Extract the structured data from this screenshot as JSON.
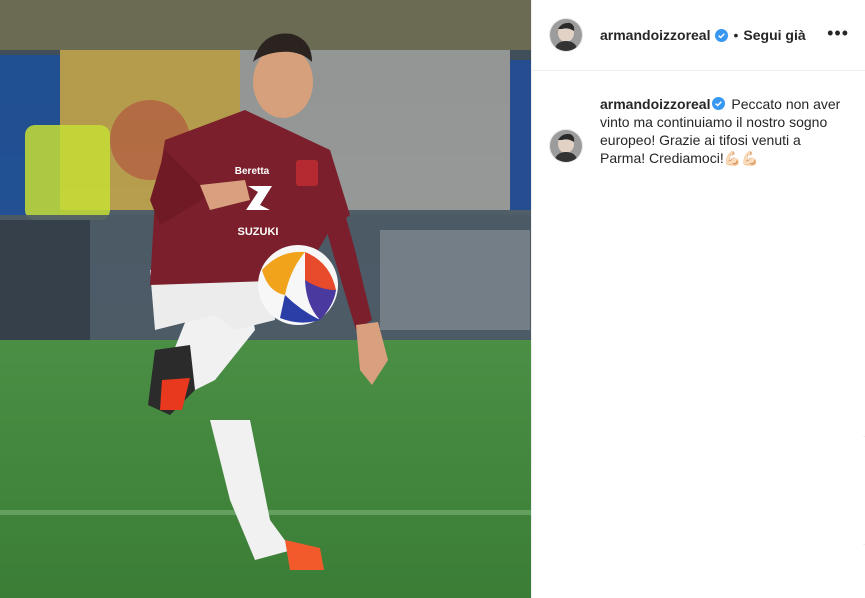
{
  "post": {
    "username": "armandoizzoreal",
    "separator": "•",
    "follow_label": "Segui già",
    "more_label": "•••",
    "caption_username": "armandoizzoreal",
    "caption_text": " Peccato non aver vinto ma continuiamo il nostro sogno europeo! Grazie ai tifosi venuti a Parma! Crediamoci!",
    "caption_emoji": "💪🏻💪🏻",
    "photo_jersey_sponsor": "SUZUKI",
    "photo_jersey_brand": "Beretta"
  },
  "colors": {
    "verified_blue": "#3897f0",
    "maroon": "#7a1f2b",
    "pitch_green": "#3f8a3a"
  },
  "icons": {
    "verified": "verified-badge-icon",
    "more": "more-options-icon"
  }
}
